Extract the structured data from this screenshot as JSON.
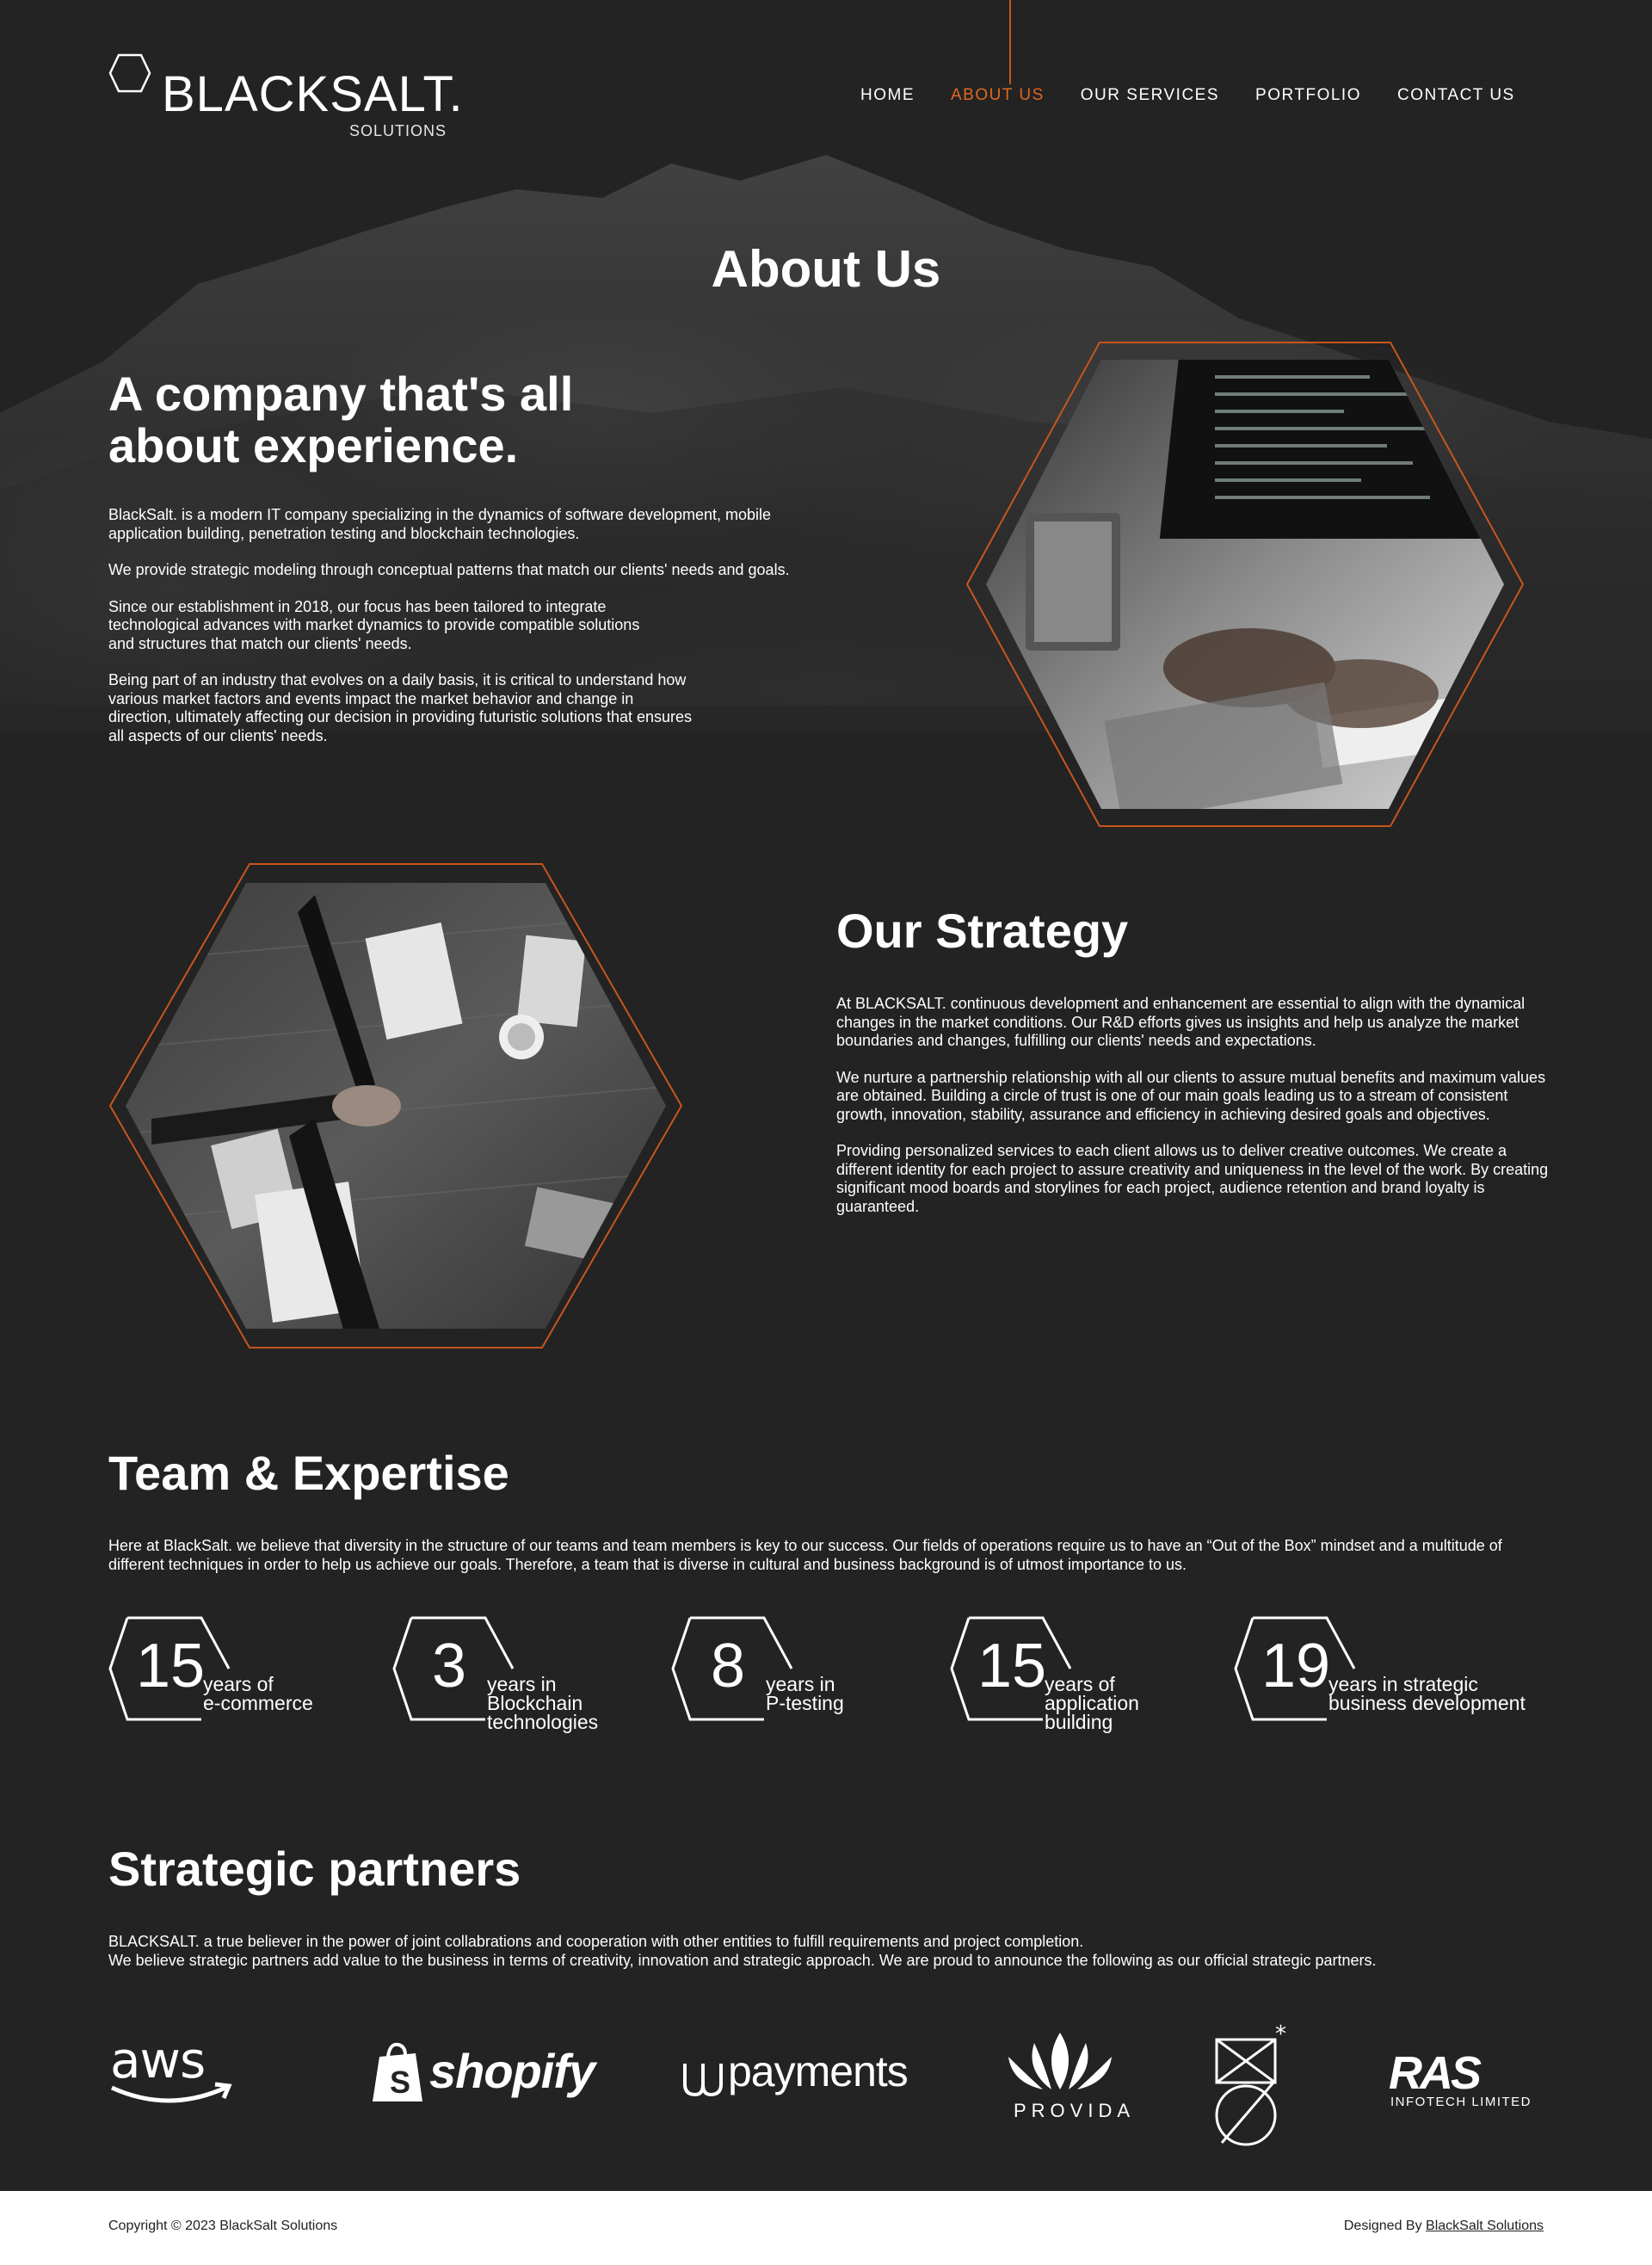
{
  "brand": {
    "name": "BLACKSALT.",
    "sub": "SOLUTIONS"
  },
  "nav": {
    "items": [
      {
        "label": "HOME",
        "active": false
      },
      {
        "label": "ABOUT US",
        "active": true
      },
      {
        "label": "OUR SERVICES",
        "active": false
      },
      {
        "label": "PORTFOLIO",
        "active": false
      },
      {
        "label": "CONTACT US",
        "active": false
      }
    ]
  },
  "colors": {
    "accent": "#e06820",
    "background": "#232323",
    "footer": "#ffffff"
  },
  "page_title": "About Us",
  "experience": {
    "heading_line1": "A company that's all",
    "heading_line2": "about experience.",
    "p1": "BlackSalt. is a modern IT company specializing in the dynamics of software development, mobile application building, penetration testing and blockchain technologies.",
    "p2": "We provide strategic modeling through conceptual patterns that match our clients' needs and goals.",
    "p3": "Since our establishment in 2018, our focus has been tailored to integrate technological advances with market dynamics to provide compatible solutions and structures that match our clients' needs.",
    "p4": "Being part of an industry that evolves on a daily basis, it is critical to understand how various market factors and events impact the market behavior and change in direction, ultimately affecting our decision in providing futuristic solutions that ensures all aspects of our clients' needs."
  },
  "strategy": {
    "heading": "Our Strategy",
    "p1": "At BLACKSALT. continuous development and enhancement are essential to align with the dynamical  changes in the market conditions. Our R&D efforts gives us insights and help us analyze the market boundaries and changes, fulfilling our clients' needs and expectations.",
    "p2": "We nurture a partnership relationship with all our clients to assure mutual benefits and maximum values are obtained. Building a circle of trust is one of our main goals leading us to a stream of consistent growth, innovation, stability, assurance and efficiency in achieving desired goals and objectives.",
    "p3": "Providing personalized services to each client allows us to deliver creative outcomes. We create a different identity for  each project to assure creativity and uniqueness in the level of the work. By creating significant mood boards and storylines for each project, audience retention and brand loyalty is guaranteed."
  },
  "team": {
    "heading": "Team & Expertise",
    "text": "Here at BlackSalt. we believe that diversity in the structure of our teams and team members is key to our success. Our fields of operations require us to have an “Out of the Box” mindset and a multitude of different techniques in order to help us achieve our goals. Therefore, a team that is diverse in cultural and business background is of utmost importance to us.",
    "stats": [
      {
        "number": "15",
        "line1": "years of",
        "line2": "e-commerce",
        "line3": ""
      },
      {
        "number": "3",
        "line1": "years in",
        "line2": "Blockchain",
        "line3": "technologies"
      },
      {
        "number": "8",
        "line1": "years in",
        "line2": "P-testing",
        "line3": ""
      },
      {
        "number": "15",
        "line1": "years of",
        "line2": "application",
        "line3": "building"
      },
      {
        "number": "19",
        "line1": "years in strategic",
        "line2": "business development",
        "line3": ""
      }
    ]
  },
  "partners": {
    "heading": "Strategic partners",
    "line1": "BLACKSALT. a  true believer in the power of joint collabrations and cooperation with other entities to fulfill requirements and project completion.",
    "line2": "We believe strategic partners add value to the business in terms of creativity, innovation and strategic approach. We are proud to announce the following as our official strategic partners.",
    "logos": {
      "aws": "aws",
      "shopify": "shopify",
      "payments": "payments",
      "provida": "PROVIDA",
      "ras": "RAS",
      "ras_sub": "INFOTECH LIMITED"
    }
  },
  "footer": {
    "copyright": "Copyright © 2023 BlackSalt Solutions",
    "designed_by": "Designed By ",
    "designed_link": "BlackSalt Solutions"
  }
}
